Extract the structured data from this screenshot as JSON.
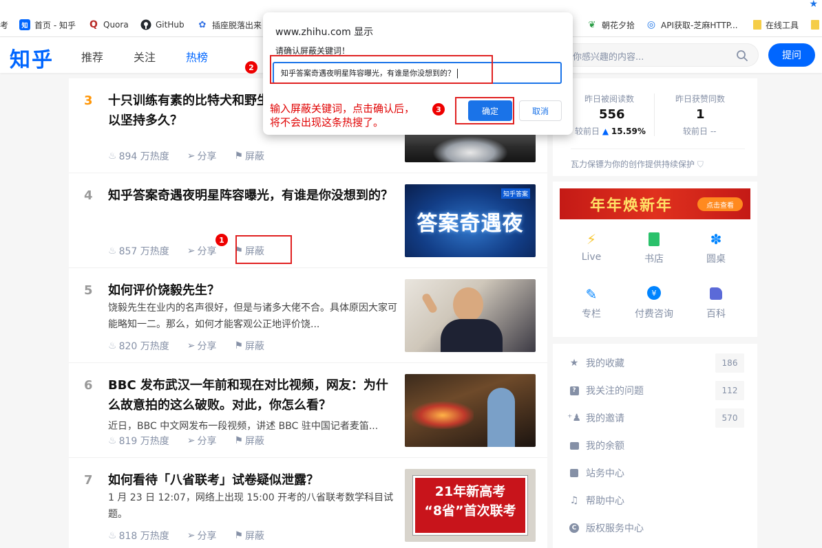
{
  "bookmarks": [
    {
      "label": "考",
      "icon": "none"
    },
    {
      "label": "首页 - 知乎",
      "icon": "zhihu-icon"
    },
    {
      "label": "Quora",
      "icon": "quora-icon"
    },
    {
      "label": "GitHub",
      "icon": "github-icon"
    },
    {
      "label": "插座脱落出来",
      "icon": "paw-icon"
    },
    {
      "label": "朝花夕拾",
      "icon": "leaf-icon"
    },
    {
      "label": "API获取-芝麻HTTP...",
      "icon": "globe-icon"
    },
    {
      "label": "在线工具",
      "icon": "folder-icon"
    }
  ],
  "header": {
    "logo": "知乎",
    "nav": [
      "推荐",
      "关注",
      "热榜"
    ],
    "search_placeholder": "索你感兴趣的内容...",
    "ask_button": "提问"
  },
  "hot_list": [
    {
      "rank": "3",
      "title": "十只训练有素的比特犬和野生东北虎打起来，能坚持多久？",
      "title_visible": "十只训练有素的比特犬和野生\n以坚持多久？",
      "excerpt": "",
      "heat": "894 万热度",
      "share": "分享",
      "block": "屏蔽"
    },
    {
      "rank": "4",
      "title": "知乎答案奇遇夜明星阵容曝光，有谁是你没想到的？",
      "excerpt": "",
      "heat": "857 万热度",
      "share": "分享",
      "block": "屏蔽"
    },
    {
      "rank": "5",
      "title": "如何评价饶毅先生？",
      "excerpt": "饶毅先生在业内的名声很好，但是与诸多大佬不合。具体原因大家可能略知一二。那么，如何才能客观公正地评价饶...",
      "heat": "820 万热度",
      "share": "分享",
      "block": "屏蔽"
    },
    {
      "rank": "6",
      "title": "BBC 发布武汉一年前和现在对比视频，网友：为什么故意拍的这么破败。对此，你怎么看？",
      "excerpt": "近日，BBC 中文网发布一段视频，讲述 BBC 驻中国记者麦笛...",
      "heat": "819 万热度",
      "share": "分享",
      "block": "屏蔽"
    },
    {
      "rank": "7",
      "title": "如何看待「八省联考」试卷疑似泄露？",
      "excerpt": "1 月 23 日 12:07，网络上出现 15:00 开考的八省联考数学科目试题。",
      "heat": "818 万热度",
      "share": "分享",
      "block": "屏蔽"
    }
  ],
  "thumb_text": {
    "t4_line1": "答案奇遇夜",
    "t4_tag": "知乎答案",
    "t7_line1": "21年新高考",
    "t7_line2": "“8省”首次联考"
  },
  "sidebar": {
    "stats": [
      {
        "label": "昨日被阅读数",
        "value": "556",
        "compare_prefix": "较前日",
        "compare_value": "15.59%"
      },
      {
        "label": "昨日获赞同数",
        "value": "1",
        "compare_prefix": "较前日",
        "compare_value": "--"
      }
    ],
    "protect_text": "瓦力保镖为你的创作提供持续保护",
    "banner_text": "年年焕新年",
    "banner_button": "点击查看",
    "apps": [
      {
        "label": "Live",
        "icon": "lightning-icon"
      },
      {
        "label": "书店",
        "icon": "book-icon"
      },
      {
        "label": "圆桌",
        "icon": "flower-icon"
      },
      {
        "label": "专栏",
        "icon": "pen-icon"
      },
      {
        "label": "付费咨询",
        "icon": "chat-yen-icon"
      },
      {
        "label": "百科",
        "icon": "encyclopedia-icon"
      }
    ],
    "menu": [
      {
        "label": "我的收藏",
        "icon": "star-icon",
        "count": "186"
      },
      {
        "label": "我关注的问题",
        "icon": "question-icon",
        "count": "112"
      },
      {
        "label": "我的邀请",
        "icon": "user-add-icon",
        "count": "570"
      },
      {
        "label": "我的余额",
        "icon": "wallet-icon",
        "count": ""
      },
      {
        "label": "站务中心",
        "icon": "notice-icon",
        "count": ""
      },
      {
        "label": "帮助中心",
        "icon": "headset-icon",
        "count": ""
      },
      {
        "label": "版权服务中心",
        "icon": "copyright-icon",
        "count": ""
      }
    ]
  },
  "dialog": {
    "title": "www.zhihu.com 显示",
    "prompt": "请确认屏蔽关键词！",
    "input_value": "知乎答案奇遇夜明星阵容曝光，有谁是你没想到的？",
    "ok": "确定",
    "cancel": "取消",
    "annotation_line1": "输入屏蔽关键词，点击确认后，",
    "annotation_line2": "将不会出现这条热搜了。"
  },
  "markers": [
    "1",
    "2",
    "3"
  ],
  "colors": {
    "brand": "#0066ff",
    "annotation": "#e00000",
    "dialog_accent": "#1a73e8",
    "rank_hot": "#ff9607"
  }
}
